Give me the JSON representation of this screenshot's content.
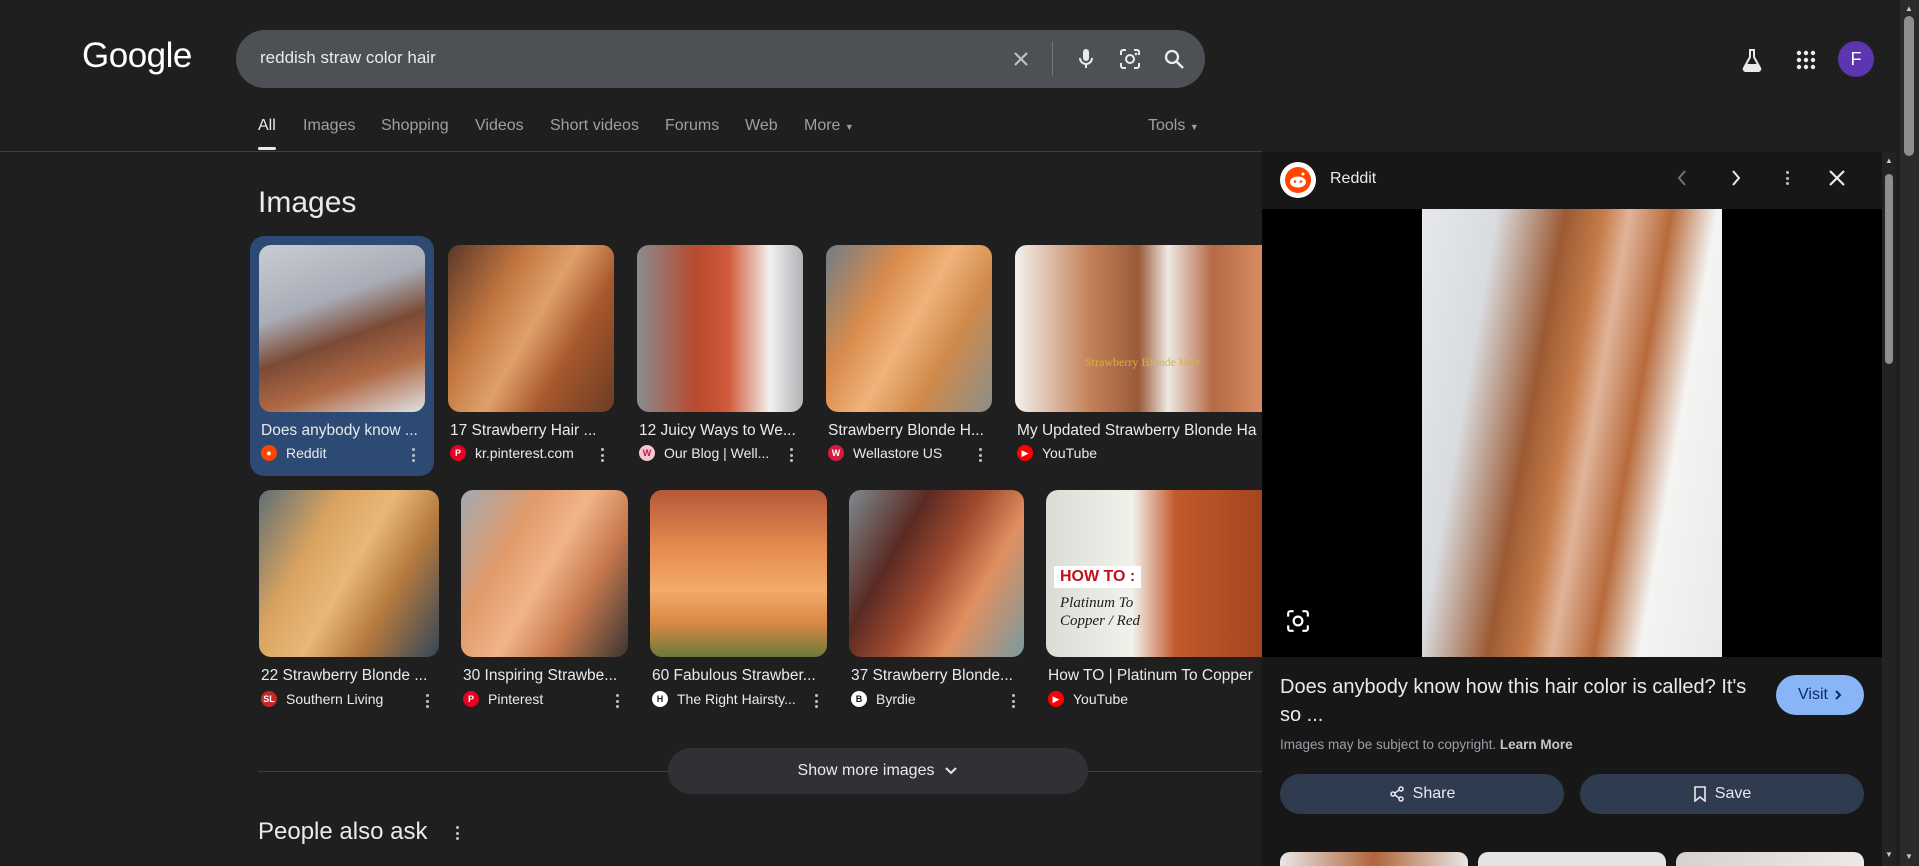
{
  "search": {
    "logo": "Google",
    "query": "reddish straw color hair"
  },
  "tabs": [
    "All",
    "Images",
    "Shopping",
    "Videos",
    "Short videos",
    "Forums",
    "Web",
    "More",
    "Tools"
  ],
  "header": {
    "avatar_letter": "F"
  },
  "images_section": {
    "heading": "Images",
    "row1": [
      {
        "caption": "Does anybody know ...",
        "source": "Reddit"
      },
      {
        "caption": "17 Strawberry Hair ...",
        "source": "kr.pinterest.com"
      },
      {
        "caption": "12 Juicy Ways to We...",
        "source": "Our Blog | Well..."
      },
      {
        "caption": "Strawberry Blonde H...",
        "source": "Wellastore US"
      },
      {
        "caption": "My Updated Strawberry Blonde Ha",
        "source": "YouTube"
      }
    ],
    "row2": [
      {
        "caption": "22 Strawberry Blonde ...",
        "source": "Southern Living"
      },
      {
        "caption": "30 Inspiring Strawbe...",
        "source": "Pinterest"
      },
      {
        "caption": "60 Fabulous Strawber...",
        "source": "The Right Hairsty..."
      },
      {
        "caption": "37 Strawberry Blonde...",
        "source": "Byrdie"
      },
      {
        "caption": "How TO | Platinum To Copper",
        "source": "YouTube"
      }
    ],
    "show_more": "Show more images",
    "people_also_ask": "People also ask",
    "thumb_text_1": "Strawberry Blonde Hair",
    "thumb_text_2": "HOW TO :",
    "thumb_text_3": "Platinum To Copper / Red"
  },
  "panel": {
    "source": "Reddit",
    "title": "Does anybody know how this hair color is called? It's so ...",
    "visit_label": "Visit",
    "copyright": "Images may be subject to copyright.",
    "learn_more": "Learn More",
    "share_label": "Share",
    "save_label": "Save"
  },
  "colors": {
    "background": "#1f1f1f",
    "accent": "#8ab4f8",
    "selected": "#2c4a73",
    "avatar": "#5e35b1"
  }
}
